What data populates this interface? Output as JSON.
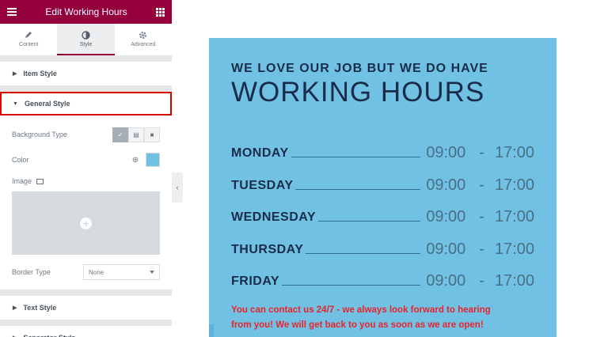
{
  "topbar": {
    "title": "Edit Working Hours",
    "menu_icon": "hamburger-icon",
    "apps_icon": "grid-icon"
  },
  "tabs": [
    {
      "label": "Content",
      "icon": "pencil-icon"
    },
    {
      "label": "Style",
      "icon": "half-circle-icon",
      "active": true
    },
    {
      "label": "Advanced",
      "icon": "gear-icon"
    }
  ],
  "sections": {
    "item_style": "Item Style",
    "general_style": "General Style",
    "text_style": "Text Style",
    "separator_style": "Separator Style"
  },
  "general": {
    "background_type_label": "Background Type",
    "color_label": "Color",
    "color_value": "#71c1e4",
    "image_label": "Image",
    "border_type_label": "Border Type",
    "border_type_value": "None"
  },
  "preview": {
    "eyebrow": "WE LOVE OUR JOB BUT WE DO HAVE",
    "heading": "WORKING HOURS",
    "separator": "-",
    "days": [
      {
        "name": "MONDAY",
        "open": "09:00",
        "close": "17:00"
      },
      {
        "name": "TUESDAY",
        "open": "09:00",
        "close": "17:00"
      },
      {
        "name": "WEDNESDAY",
        "open": "09:00",
        "close": "17:00"
      },
      {
        "name": "THURSDAY",
        "open": "09:00",
        "close": "17:00"
      },
      {
        "name": "FRIDAY",
        "open": "09:00",
        "close": "17:00"
      }
    ],
    "contact_line1": "You can contact us 24/7 - we always look forward to hearing",
    "contact_line2": "from you! We will get back to you as soon as we are open!"
  },
  "colors": {
    "brand": "#93003c",
    "card_bg": "#71c1e4",
    "heading": "#192c4a",
    "contact": "#e8232b",
    "highlight": "#d90000"
  }
}
